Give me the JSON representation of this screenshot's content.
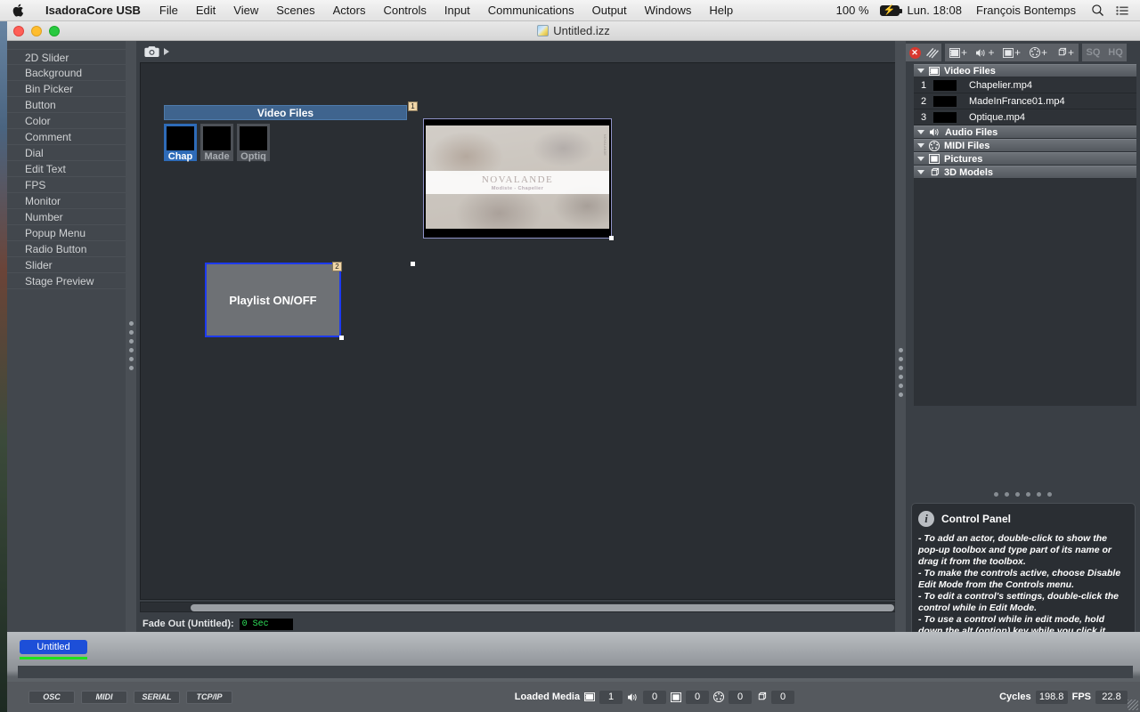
{
  "menubar": {
    "apple": "apple-logo",
    "app_name": "IsadoraCore USB",
    "items": [
      "File",
      "Edit",
      "View",
      "Scenes",
      "Actors",
      "Controls",
      "Input",
      "Communications",
      "Output",
      "Windows",
      "Help"
    ],
    "battery_percent": "100 %",
    "clock": "Lun. 18:08",
    "user": "François Bontemps",
    "search_icon": "search-icon",
    "list_icon": "control-center-icon"
  },
  "window": {
    "title": "Untitled.izz",
    "traffic": {
      "close": "close",
      "minimize": "minimize",
      "zoom": "zoom"
    }
  },
  "toolbox": {
    "items": [
      "2D Slider",
      "Background",
      "Bin Picker",
      "Button",
      "Color",
      "Comment",
      "Dial",
      "Edit Text",
      "FPS",
      "Monitor",
      "Number",
      "Popup Menu",
      "Radio Button",
      "Slider",
      "Stage Preview"
    ]
  },
  "editor": {
    "snapshot_icon": "camera-icon",
    "snapshot_arrow": "play-triangle-icon",
    "bin_picker": {
      "title": "Video Files",
      "badge": "1",
      "cells": [
        {
          "label": "Chapelier.mp4",
          "short": "Chap",
          "selected": true
        },
        {
          "label": "MadeInFrance01.mp4",
          "short": "Made",
          "selected": false
        },
        {
          "label": "Optique.mp4",
          "short": "Optiq",
          "selected": false
        }
      ]
    },
    "stage_preview": {
      "overlay_title": "NOVALANDE",
      "overlay_subtitle": "Modiste - Chapelier",
      "vertical_text": "NOVALANDE"
    },
    "playlist_button": {
      "label": "Playlist ON/OFF",
      "badge": "2"
    },
    "fade_out": {
      "label": "Fade Out (Untitled):",
      "value": "0 Sec"
    }
  },
  "media_panel": {
    "toolbar": {
      "delete_icon": "delete-media-icon",
      "relink_icon": "broken-link-icon",
      "add_video": "add-video-icon",
      "add_audio": "add-audio-icon",
      "add_picture": "add-picture-icon",
      "add_midi": "add-midi-icon",
      "add_3d": "add-3d-model-icon",
      "sq_label": "SQ",
      "hq_label": "HQ"
    },
    "bins": [
      {
        "name": "Video Files",
        "icon": "film-icon",
        "expanded": true,
        "rows": [
          {
            "num": "1",
            "name": "Chapelier.mp4"
          },
          {
            "num": "2",
            "name": "MadeInFrance01.mp4"
          },
          {
            "num": "3",
            "name": "Optique.mp4"
          }
        ]
      },
      {
        "name": "Audio Files",
        "icon": "speaker-icon",
        "expanded": true,
        "rows": []
      },
      {
        "name": "MIDI Files",
        "icon": "midi-icon",
        "expanded": true,
        "rows": []
      },
      {
        "name": "Pictures",
        "icon": "picture-icon",
        "expanded": true,
        "rows": []
      },
      {
        "name": "3D Models",
        "icon": "cube-icon",
        "expanded": true,
        "rows": []
      }
    ]
  },
  "control_panel_help": {
    "icon": "info-icon",
    "title": "Control Panel",
    "lines": [
      "- To add an actor, double-click to show the pop-up toolbox and type part of its name or drag it from the toolbox.",
      "- To make the controls active, choose Disable Edit Mode from the Controls menu.",
      "- To edit a control's settings, double-click the control while in Edit Mode.",
      "- To use a control while in edit mode, hold down the alt (option) key while you click it."
    ]
  },
  "scene_tabs": {
    "tabs": [
      {
        "label": "Untitled",
        "active": true
      }
    ]
  },
  "statusbar": {
    "protocols": [
      "OSC",
      "MIDI",
      "SERIAL",
      "TCP/IP"
    ],
    "loaded_media_label": "Loaded Media",
    "counts": [
      {
        "icon": "film-icon",
        "value": "1"
      },
      {
        "icon": "speaker-icon",
        "value": "0"
      },
      {
        "icon": "picture-icon",
        "value": "0"
      },
      {
        "icon": "midi-icon",
        "value": "0"
      },
      {
        "icon": "cube-icon",
        "value": "0"
      }
    ],
    "cycles_label": "Cycles",
    "cycles_value": "198.8",
    "fps_label": "FPS",
    "fps_value": "22.8"
  },
  "colors": {
    "accent_blue": "#1d3af0",
    "bin_title_blue": "#3f648e",
    "tab_blue": "#1d4fd8",
    "green_value": "#2ee05a",
    "badge_tan": "#f0d6a8"
  }
}
